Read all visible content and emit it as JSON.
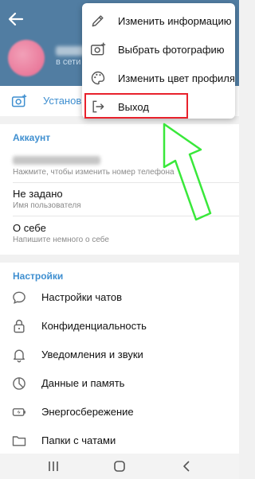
{
  "header": {
    "status": "в сети"
  },
  "photo_row": {
    "label": "Установи"
  },
  "account": {
    "title": "Аккаунт",
    "phone_hint": "Нажмите, чтобы изменить номер телефона",
    "username_value": "Не задано",
    "username_hint": "Имя пользователя",
    "about_value": "О себе",
    "about_hint": "Напишите немного о себе"
  },
  "settings": {
    "title": "Настройки",
    "items": [
      {
        "label": "Настройки чатов",
        "icon": "chat-bubble-icon"
      },
      {
        "label": "Конфиденциальность",
        "icon": "lock-icon"
      },
      {
        "label": "Уведомления и звуки",
        "icon": "bell-icon"
      },
      {
        "label": "Данные и память",
        "icon": "pie-chart-icon"
      },
      {
        "label": "Энергосбережение",
        "icon": "battery-icon"
      },
      {
        "label": "Папки с чатами",
        "icon": "folder-icon"
      }
    ]
  },
  "menu": {
    "items": [
      {
        "label": "Изменить информацию",
        "icon": "pencil-icon"
      },
      {
        "label": "Выбрать фотографию",
        "icon": "camera-add-icon"
      },
      {
        "label": "Изменить цвет профиля",
        "icon": "palette-icon"
      },
      {
        "label": "Выход",
        "icon": "logout-icon"
      }
    ]
  },
  "colors": {
    "header": "#517da2",
    "accent": "#3f8fd0",
    "highlight": "#e8212c",
    "annotation_arrow": "#39e83a"
  }
}
